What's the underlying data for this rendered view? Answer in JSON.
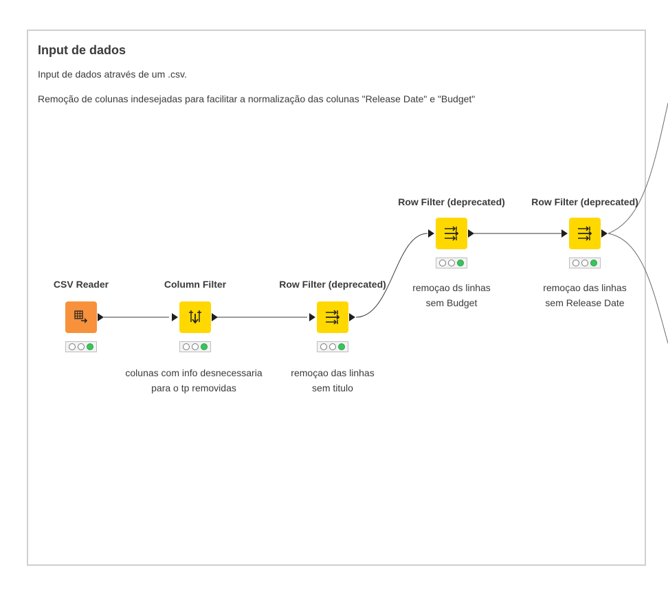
{
  "annotation": {
    "title": "Input de dados",
    "lines": [
      "Input de dados através de um .csv.",
      "Remoção de colunas indesejadas para facilitar a normalização das colunas \"Release Date\" e \"Budget\""
    ]
  },
  "colors": {
    "reader": "#f7913c",
    "manipulator": "#ffd800",
    "status_ok": "#3ac45d",
    "border": "#cfcfcf"
  },
  "nodes": [
    {
      "title": "CSV Reader",
      "desc1": "",
      "desc2": "",
      "icon": "csv-reader-icon"
    },
    {
      "title": "Column Filter",
      "desc1": "colunas com info desnecessaria",
      "desc2": "para o tp removidas",
      "icon": "column-filter-icon"
    },
    {
      "title": "Row Filter (deprecated)",
      "desc1": "remoçao das linhas",
      "desc2": "sem titulo",
      "icon": "row-filter-icon"
    },
    {
      "title": "Row Filter (deprecated)",
      "desc1": "remoçao ds linhas",
      "desc2": "sem Budget",
      "icon": "row-filter-icon"
    },
    {
      "title": "Row Filter (deprecated)",
      "desc1": "remoçao das linhas",
      "desc2": "sem Release Date",
      "icon": "row-filter-icon"
    }
  ]
}
